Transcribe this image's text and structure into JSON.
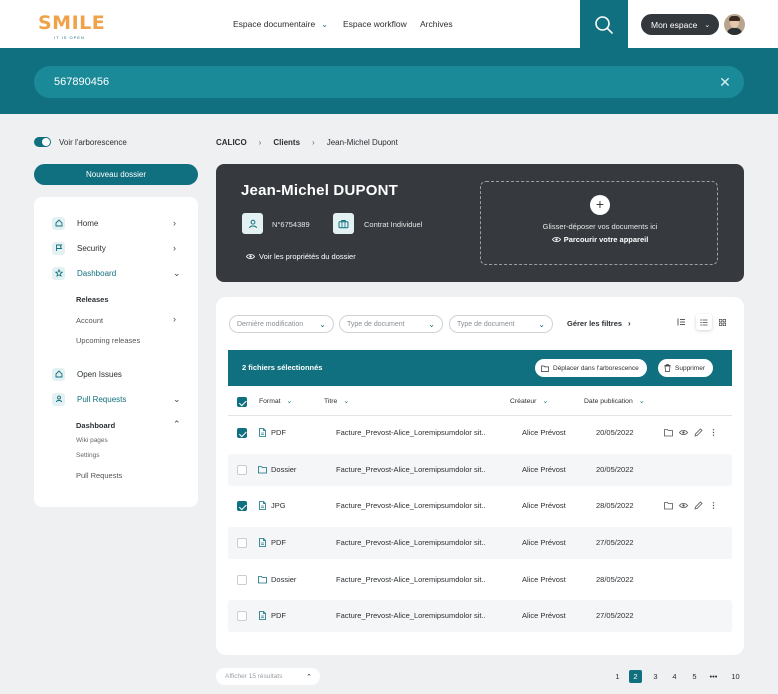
{
  "brand": {
    "name": "SMILE",
    "tagline": "IT IS OPEN"
  },
  "nav": {
    "items": [
      "Espace documentaire",
      "Espace workflow",
      "Archives"
    ]
  },
  "user_menu": {
    "label": "Mon espace"
  },
  "search": {
    "value": "567890456"
  },
  "sidebar": {
    "toggle_label": "Voir l'arborescence",
    "new_folder_label": "Nouveau dossier",
    "items": [
      {
        "label": "Home"
      },
      {
        "label": "Security"
      },
      {
        "label": "Dashboard"
      },
      {
        "label": "Open Issues"
      },
      {
        "label": "Pull Requests"
      }
    ],
    "dashboard_sub": [
      "Releases",
      "Account",
      "Upcoming releases"
    ],
    "pull_requests_sub": {
      "group": "Dashboard",
      "items": [
        "Wiki pages",
        "Settings"
      ],
      "last": "Pull Requests"
    }
  },
  "breadcrumb": [
    "CALICO",
    "Clients",
    "Jean-Michel Dupont"
  ],
  "dossier": {
    "title": "Jean-Michel DUPONT",
    "number": "N°6754389",
    "contract": "Contrat Individuel",
    "props_link": "Voir les propriétés du dossier",
    "drop_text": "Glisser-déposer vos documents ici",
    "browse_link": "Parcourir votre appareil"
  },
  "filters": {
    "placeholders": [
      "Dernière modification",
      "Type de document",
      "Type de document"
    ],
    "manage": "Gérer les filtres"
  },
  "selection": {
    "count_text": "2 fichiers sélectionnés",
    "move_label": "Déplacer dans l'arborescence",
    "delete_label": "Supprimer"
  },
  "table": {
    "columns": [
      "Format",
      "Titre",
      "Créateur",
      "Date publication"
    ],
    "rows": [
      {
        "checked": true,
        "format": "PDF",
        "title": "Facture_Prevost-Alice_Loremipsumdolor sit..",
        "creator": "Alice Prévost",
        "date": "20/05/2022",
        "actions": true
      },
      {
        "checked": false,
        "format": "Dossier",
        "title": "Facture_Prevost-Alice_Loremipsumdolor sit..",
        "creator": "Alice Prévost",
        "date": "20/05/2022",
        "actions": false
      },
      {
        "checked": true,
        "format": "JPG",
        "title": "Facture_Prevost-Alice_Loremipsumdolor sit..",
        "creator": "Alice Prévost",
        "date": "28/05/2022",
        "actions": true
      },
      {
        "checked": false,
        "format": "PDF",
        "title": "Facture_Prevost-Alice_Loremipsumdolor sit..",
        "creator": "Alice Prévost",
        "date": "27/05/2022",
        "actions": false
      },
      {
        "checked": false,
        "format": "Dossier",
        "title": "Facture_Prevost-Alice_Loremipsumdolor sit..",
        "creator": "Alice Prévost",
        "date": "28/05/2022",
        "actions": false
      },
      {
        "checked": false,
        "format": "PDF",
        "title": "Facture_Prevost-Alice_Loremipsumdolor sit..",
        "creator": "Alice Prévost",
        "date": "27/05/2022",
        "actions": false
      }
    ]
  },
  "footer": {
    "per_page": "Afficher 15 résultats",
    "pages": [
      "1",
      "2",
      "3",
      "4",
      "5",
      "•••",
      "10"
    ],
    "current_page": "2"
  },
  "colors": {
    "primary": "#11707f",
    "dark_card": "#363a3f",
    "accent_logo": "#f0a24a"
  }
}
